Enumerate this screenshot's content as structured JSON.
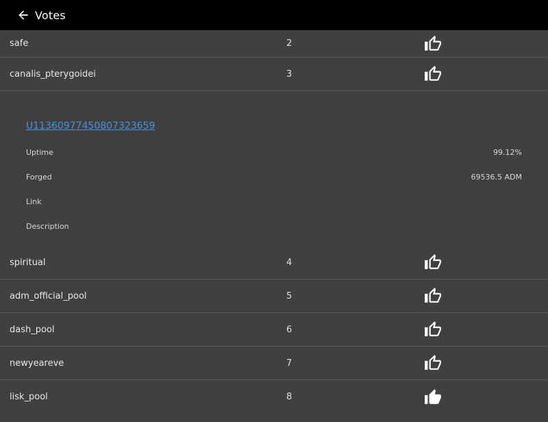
{
  "header": {
    "title": "Votes"
  },
  "rows_top": [
    {
      "name": "safe",
      "rank": "2"
    },
    {
      "name": "canalis_pterygoidei",
      "rank": "3"
    }
  ],
  "details": {
    "address": "U11360977450807323659",
    "fields": [
      {
        "label": "Uptime",
        "value": "99.12%"
      },
      {
        "label": "Forged",
        "value": "69536.5 ADM"
      },
      {
        "label": "Link",
        "value": ""
      },
      {
        "label": "Description",
        "value": ""
      }
    ]
  },
  "rows_bottom": [
    {
      "name": "spiritual",
      "rank": "4",
      "voted": false
    },
    {
      "name": "adm_official_pool",
      "rank": "5",
      "voted": false
    },
    {
      "name": "dash_pool",
      "rank": "6",
      "voted": false
    },
    {
      "name": "newyeareve",
      "rank": "7",
      "voted": false
    },
    {
      "name": "lisk_pool",
      "rank": "8",
      "voted": true
    }
  ],
  "icons": {
    "back": "arrow-left-icon",
    "vote": "thumb-up-outline-icon",
    "voted": "thumb-up-filled-icon"
  },
  "colors": {
    "app_bar": "#000000",
    "background": "#404040",
    "link": "#4a90e2",
    "divider": "#5c5c5c"
  }
}
